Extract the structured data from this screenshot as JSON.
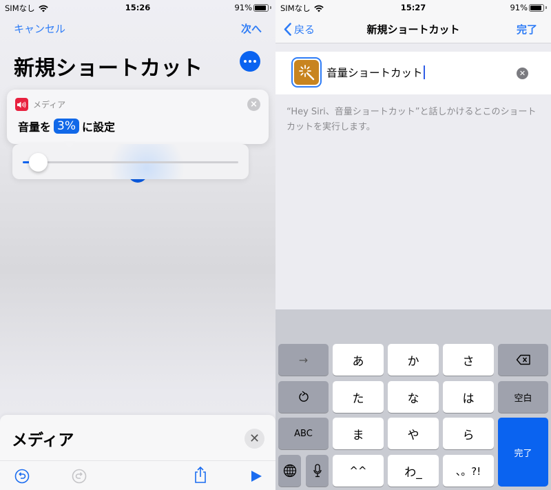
{
  "left": {
    "status": {
      "carrier": "SIMなし",
      "time": "15:26",
      "battery": "91%",
      "battery_level": 0.91
    },
    "nav": {
      "cancel": "キャンセル",
      "next": "次へ"
    },
    "title": "新規ショートカット",
    "more_icon": "ellipsis-icon",
    "action_card": {
      "category": "メディア",
      "icon": "speaker-icon",
      "prefix": "音量を",
      "value": "3%",
      "suffix": "に設定"
    },
    "slider": {
      "value": 0.03
    },
    "sheet": {
      "title": "メディア"
    },
    "toolbar": [
      "undo-icon",
      "redo-icon",
      "share-icon",
      "play-icon"
    ]
  },
  "right": {
    "status": {
      "carrier": "SIMなし",
      "time": "15:27",
      "battery": "91%",
      "battery_level": 0.91
    },
    "nav": {
      "back": "戻る",
      "title": "新規ショートカット",
      "done": "完了"
    },
    "name_field": {
      "value": "音量ショートカット"
    },
    "hint": "“Hey Siri、音量ショートカット”と話しかけるとこのショートカットを実行します。",
    "keyboard": {
      "row1": [
        "→",
        "あ",
        "か",
        "さ",
        "⌫"
      ],
      "row2": [
        "↺",
        "た",
        "な",
        "は",
        "空白"
      ],
      "row3": [
        "ABC",
        "ま",
        "や",
        "ら"
      ],
      "row4": [
        "🌐",
        "🎤",
        "^^",
        "わ_",
        "、。?!"
      ],
      "done": "完了"
    }
  }
}
